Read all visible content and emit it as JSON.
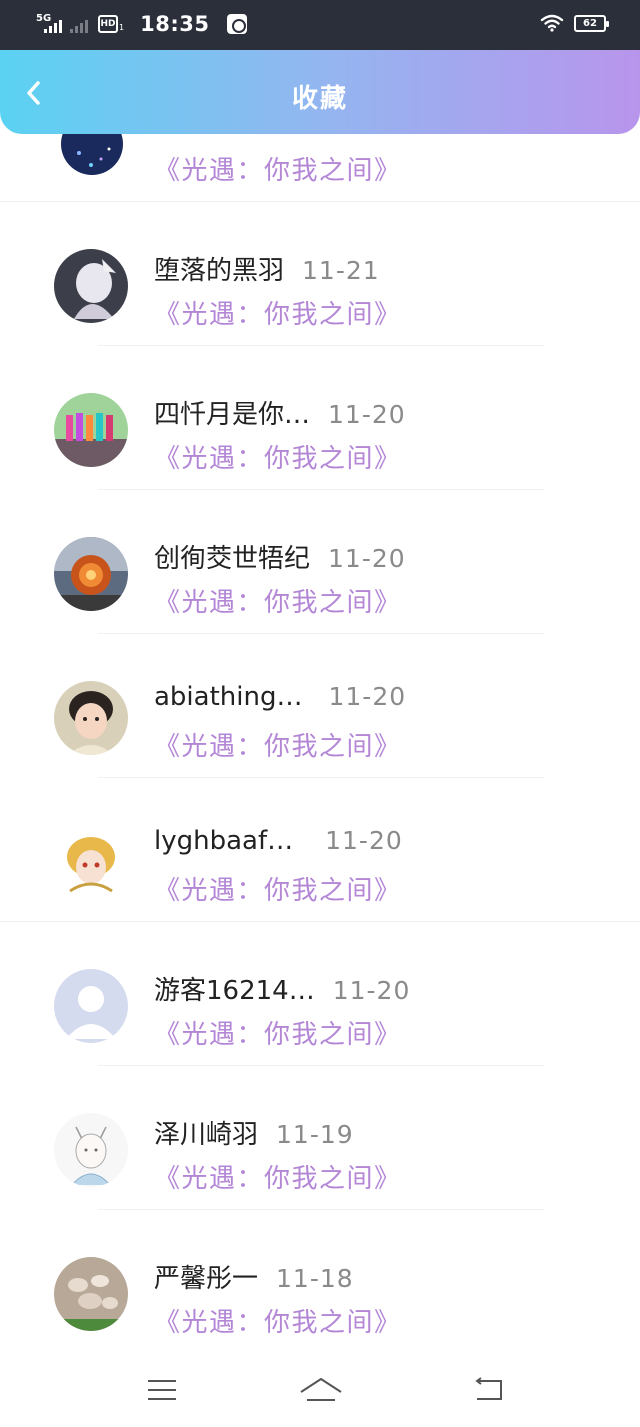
{
  "status_bar": {
    "network": "5G",
    "hd_label": "HD",
    "hd_sub": "1",
    "time": "18:35",
    "battery": "62"
  },
  "header": {
    "title": "收藏"
  },
  "collect_title": "《光遇：你我之间》",
  "items": [
    {
      "name": "",
      "date": "",
      "title": "《光遇：你我之间》"
    },
    {
      "name": "堕落的黑羽",
      "date": "11-21",
      "title": "《光遇：你我之间》"
    },
    {
      "name": "四忏月是你…",
      "date": "11-20",
      "title": "《光遇：你我之间》"
    },
    {
      "name": "创徇茭世牾纪",
      "date": "11-20",
      "title": "《光遇：你我之间》"
    },
    {
      "name": "abiathing…",
      "date": "11-20",
      "title": "《光遇：你我之间》"
    },
    {
      "name": "lyghbaaf…",
      "date": "11-20",
      "title": "《光遇：你我之间》"
    },
    {
      "name": "游客16214…",
      "date": "11-20",
      "title": "《光遇：你我之间》"
    },
    {
      "name": "泽川崎羽",
      "date": "11-19",
      "title": "《光遇：你我之间》"
    },
    {
      "name": "严馨彤一",
      "date": "11-18",
      "title": "《光遇：你我之间》"
    }
  ],
  "icons": {
    "back": "chevron-left-icon",
    "menu": "menu-icon",
    "home": "home-icon",
    "return": "return-icon",
    "wifi": "wifi-icon"
  },
  "colors": {
    "header_start": "#5bd2f2",
    "header_end": "#b895ec",
    "title_purple": "#b487d6",
    "date_gray": "#8a8a8a"
  }
}
